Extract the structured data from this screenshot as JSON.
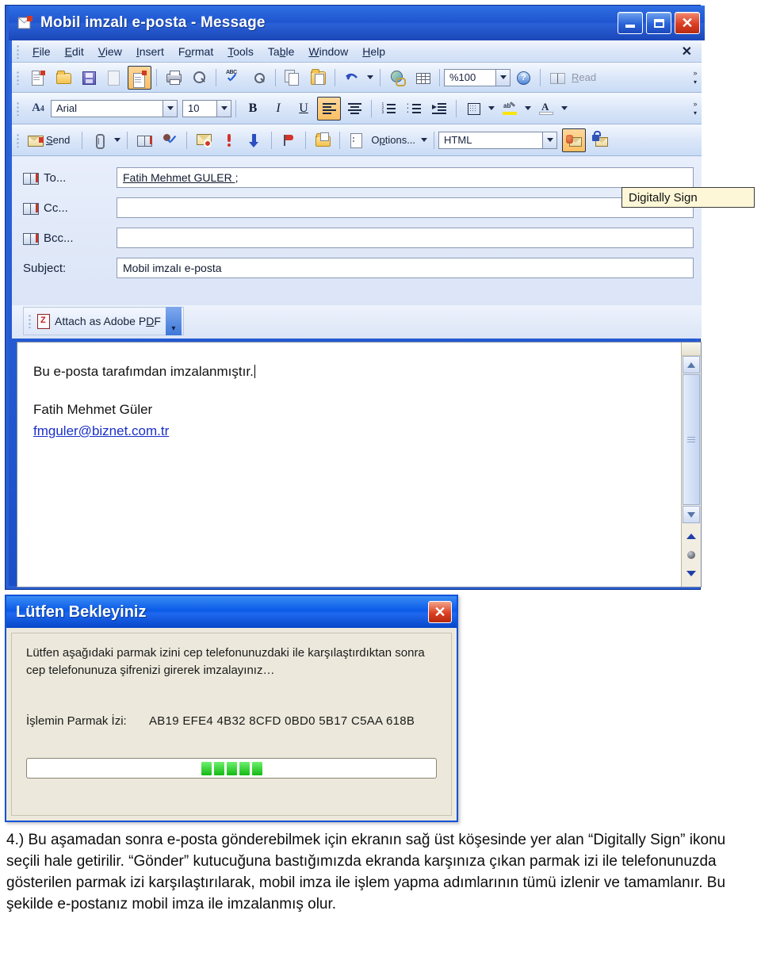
{
  "window": {
    "title": "Mobil imzalı e-posta - Message",
    "title_icon": "message-envelope-icon",
    "buttons": {
      "minimize": "minimize-button",
      "maximize": "maximize-button",
      "close": "close-button",
      "close_glyph": "✕"
    }
  },
  "menubar": {
    "items": [
      {
        "label": "File",
        "accel": "F"
      },
      {
        "label": "Edit",
        "accel": "E"
      },
      {
        "label": "View",
        "accel": "V"
      },
      {
        "label": "Insert",
        "accel": "I"
      },
      {
        "label": "Format",
        "accel": "o"
      },
      {
        "label": "Tools",
        "accel": "T"
      },
      {
        "label": "Table",
        "accel": "b"
      },
      {
        "label": "Window",
        "accel": "W"
      },
      {
        "label": "Help",
        "accel": "H"
      }
    ],
    "close_label": "✕"
  },
  "standard_toolbar": {
    "icons": [
      "new-mail-message-icon",
      "open-folder-icon",
      "save-icon",
      "print-preview-page-icon",
      "send-receive-icon",
      "print-icon",
      "print-preview-icon",
      "spelling-abc-check-icon",
      "research-icon",
      "copy-icon",
      "paste-icon",
      "undo-icon"
    ],
    "zoom_value": "%100",
    "help_glyph": "?",
    "read_label": "Read",
    "read_icon": "reading-pane-icon"
  },
  "formatting_toolbar": {
    "style_icon": "style-A-icon",
    "font_name": "Arial",
    "font_size": "10",
    "bold": "B",
    "italic": "I",
    "underline": "U",
    "icons": [
      "align-left-icon",
      "align-center-icon",
      "numbered-list-icon",
      "bulleted-list-icon",
      "increase-indent-icon",
      "borders-icon",
      "highlight-icon",
      "font-color-icon"
    ]
  },
  "mail_toolbar": {
    "send_label": "Send",
    "send_accel": "S",
    "options_label": "Options...",
    "format_value": "HTML",
    "icons": [
      "attach-file-icon",
      "address-book-icon",
      "check-names-icon",
      "block-message-icon",
      "high-importance-icon",
      "low-importance-icon",
      "follow-up-flag-icon",
      "open-folder-icon",
      "options-icon",
      "digitally-sign-icon",
      "encrypt-icon"
    ]
  },
  "header_fields": [
    {
      "label": "To...",
      "value": "Fatih Mehmet GULER ;",
      "icon": "address-book-icon",
      "underlined": true
    },
    {
      "label": "Cc...",
      "value": "",
      "icon": "address-book-icon",
      "underlined": false
    },
    {
      "label": "Bcc...",
      "value": "",
      "icon": "address-book-icon",
      "underlined": false
    },
    {
      "label": "Subject:",
      "value": "Mobil imzalı e-posta",
      "icon": "",
      "underlined": false
    }
  ],
  "tooltip": {
    "text": "Digitally Sign"
  },
  "attachment_bar": {
    "button_label": "Attach as Adobe PDF",
    "accel": "D",
    "icon": "adobe-pdf-icon"
  },
  "message_body": {
    "line1": "Bu e-posta tarafımdan imzalanmıştır.",
    "signature_name": "Fatih Mehmet Güler",
    "signature_email": "fmguler@biznet.com.tr"
  },
  "dialog": {
    "title": "Lütfen Bekleyiniz",
    "close_glyph": "✕",
    "message": "Lütfen aşağıdaki parmak izini cep telefonunuzdaki ile karşılaştırdıktan sonra cep telefonunuza şifrenizi girerek imzalayınız…",
    "fingerprint_label": "İşlemin Parmak İzi:",
    "fingerprint_value": "AB19 EFE4 4B32 8CFD 0BD0 5B17 C5AA 618B",
    "progress_blocks": 5,
    "progress_color": "#13b913"
  },
  "caption": {
    "text": "4.) Bu aşamadan sonra e-posta gönderebilmek için ekranın sağ üst köşesinde yer alan “Digitally Sign” ikonu seçili hale getirilir. “Gönder” kutucuğuna bastığımızda ekranda karşınıza çıkan parmak izi ile telefonunuzda gösterilen parmak izi karşılaştırılarak, mobil imza ile işlem yapma adımlarının tümü izlenir ve tamamlanır. Bu şekilde e-postanız mobil imza ile imzalanmış olur."
  },
  "colors": {
    "titlebar_blue": "#1f55cf",
    "accent_orange": "#fcbf62",
    "dialog_bg": "#ece9dc",
    "link_blue": "#1a2fc8"
  }
}
